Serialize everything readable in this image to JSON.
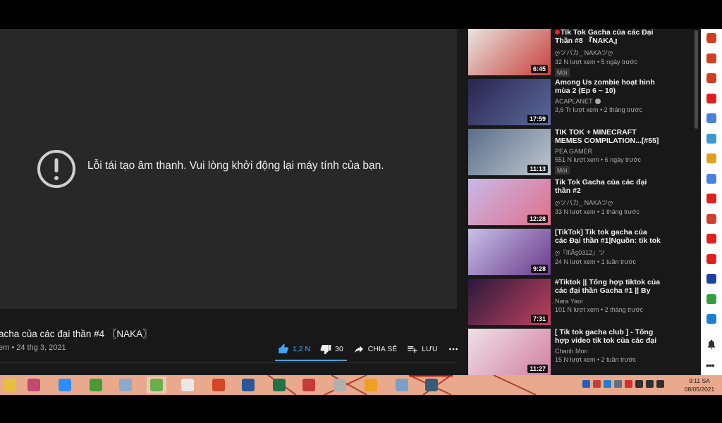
{
  "player": {
    "error_message": "Lỗi tái tạo âm thanh. Vui lòng khởi động lại máy tính của bạn."
  },
  "video": {
    "title": "acha của các đại thần #4 〖NAKA〗",
    "meta": "em • 24 thg 3, 2021",
    "likes": "1,2 N",
    "dislikes": "30",
    "share_label": "CHIA SẺ",
    "save_label": "LƯU",
    "like_ratio": 0.95
  },
  "sidebar": {
    "items": [
      {
        "title": "Tik Tok Gacha của các Đại Thần #8 『NAKA』",
        "channel": "ღツバカ_ NAKAツღ",
        "stats": "32 N lượt xem • 5 ngày trước",
        "duration": "6:45",
        "badge": "Mới",
        "live_dot": true,
        "verified": false
      },
      {
        "title": "Among Us zombie hoạt hình mùa 2 (Ep 6 ~ 10)",
        "channel": "ACAPLANET",
        "stats": "3,6 Tr lượt xem • 2 tháng trước",
        "duration": "17:59",
        "badge": "",
        "live_dot": false,
        "verified": true
      },
      {
        "title": "TIK TOK + MINECRAFT MEMES COMPILATION...[#55]",
        "channel": "PEA GAMER",
        "stats": "551 N lượt xem • 6 ngày trước",
        "duration": "11:13",
        "badge": "Mới",
        "live_dot": false,
        "verified": false
      },
      {
        "title": "Tik Tok Gacha của các đại thần #2",
        "channel": "ღツバカ_ NAKAツღ",
        "stats": "33 N lượt xem • 1 tháng trước",
        "duration": "12:28",
        "badge": "",
        "live_dot": false,
        "verified": false
      },
      {
        "title": "[TikTok] Tik tok gacha của các Đại thần #1|Nguồn: tik tok",
        "channel": "ღ『ᗰÃȿ0312』ツ",
        "stats": "24 N lượt xem • 1 tuần trước",
        "duration": "9:28",
        "badge": "",
        "live_dot": false,
        "verified": false
      },
      {
        "title": "#Tiktok || Tổng hợp tiktok của các đại thần Gacha #1 || By me",
        "channel": "Nara Yaoi",
        "stats": "101 N lượt xem • 2 tháng trước",
        "duration": "7:31",
        "badge": "",
        "live_dot": false,
        "verified": false
      },
      {
        "title": "[ Tik tok gacha club ] - Tổng hợp video tik tok của các đại thần -...",
        "channel": "Chanh Mon",
        "stats": "15 N lượt xem • 2 tuần trước",
        "duration": "11:27",
        "badge": "",
        "live_dot": false,
        "verified": false
      }
    ]
  },
  "thumb_colors": [
    [
      "#e8e4e0",
      "#c8403a"
    ],
    [
      "#2b2450",
      "#5a6a9a"
    ],
    [
      "#5a6e8a",
      "#c0c8d0"
    ],
    [
      "#c8b8e8",
      "#e0708a"
    ],
    [
      "#c8c0e8",
      "#6a3a8a"
    ],
    [
      "#2a1a3a",
      "#c04060"
    ],
    [
      "#f0e0e8",
      "#d080a0"
    ]
  ],
  "taskbar": {
    "apps": [
      "file-explorer",
      "snipping-tool",
      "zoom",
      "app-green",
      "paint",
      "app-android",
      "chrome",
      "powerpoint",
      "word",
      "excel",
      "app-red",
      "app-sketch",
      "app-notes",
      "app-photos",
      "app-globe"
    ],
    "app_colors": [
      "#e8c040",
      "#c04a70",
      "#2d8cff",
      "#4a9a3a",
      "#8aaad0",
      "#6ab04a",
      "#e8e8e8",
      "#d24726",
      "#2b579a",
      "#217346",
      "#c83a3a",
      "#b0b0b0",
      "#f0a020",
      "#7aa0c8",
      "#3a5a7a"
    ],
    "tray_icons": [
      "cloud-icon",
      "network-icon",
      "app-tray-icon",
      "app-tray-icon-2",
      "vivaldi-icon",
      "wifi-icon",
      "volume-icon",
      "flag-icon"
    ],
    "tray_colors": [
      "#2060c0",
      "#c04040",
      "#2080d0",
      "#607080",
      "#d03030",
      "#303030",
      "#303030",
      "#303030"
    ],
    "time": "9:11 SA",
    "date": "08/05/2021"
  },
  "extensions": [
    {
      "name": "leaf-icon-1",
      "color": "#d04020"
    },
    {
      "name": "leaf-icon-2",
      "color": "#d04020"
    },
    {
      "name": "leaf-icon-3",
      "color": "#d04020"
    },
    {
      "name": "text-t-icon",
      "color": "#e02020"
    },
    {
      "name": "translate-icon",
      "color": "#4a80e0"
    },
    {
      "name": "globe-icon",
      "color": "#3a9ad0"
    },
    {
      "name": "note-icon",
      "color": "#e0a020"
    },
    {
      "name": "translate-g-icon",
      "color": "#4a80e0"
    },
    {
      "name": "pinterest-icon",
      "color": "#e02020"
    },
    {
      "name": "gmail-icon",
      "color": "#d04030"
    },
    {
      "name": "opera-icon",
      "color": "#e02020"
    },
    {
      "name": "youtube-icon",
      "color": "#e02020"
    },
    {
      "name": "vtv-icon",
      "color": "#2040a0"
    },
    {
      "name": "maps-icon",
      "color": "#30a040"
    },
    {
      "name": "sale-icon",
      "color": "#2080d0"
    }
  ]
}
